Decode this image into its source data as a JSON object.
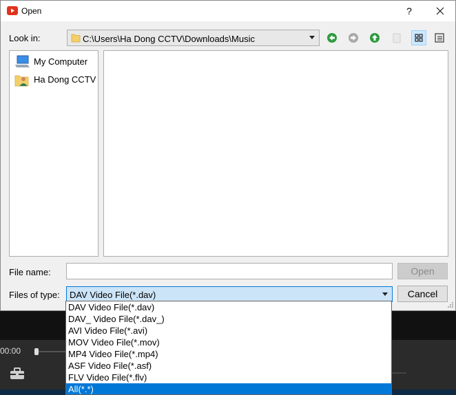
{
  "background_app": {
    "time_readout": "00:00"
  },
  "dialog": {
    "title": "Open",
    "help_label": "?",
    "look_in": {
      "label": "Look in:",
      "path": "C:\\Users\\Ha Dong CCTV\\Downloads\\Music"
    },
    "toolbar_icons": [
      "back-icon",
      "forward-icon",
      "up-folder-icon",
      "new-folder-icon",
      "detail-view-icon",
      "list-view-icon"
    ],
    "sidebar": {
      "items": [
        {
          "label": "My Computer",
          "icon": "computer-icon"
        },
        {
          "label": "Ha Dong CCTV",
          "icon": "user-folder-icon"
        }
      ]
    },
    "file_name": {
      "label": "File name:",
      "value": ""
    },
    "open_button": "Open",
    "files_of_type": {
      "label": "Files of type:",
      "selected": "DAV Video File(*.dav)",
      "options": [
        "DAV Video File(*.dav)",
        "DAV_ Video File(*.dav_)",
        "AVI Video File(*.avi)",
        "MOV Video File(*.mov)",
        "MP4 Video File(*.mp4)",
        "ASF Video File(*.asf)",
        "FLV Video File(*.flv)",
        "All(*.*)"
      ],
      "highlighted_index": 7
    },
    "cancel_button": "Cancel"
  },
  "colors": {
    "accent": "#0078d7",
    "combo_focus": "#cce4f7",
    "nav_green": "#2e9b3e",
    "title_icon_red": "#e0331c"
  }
}
